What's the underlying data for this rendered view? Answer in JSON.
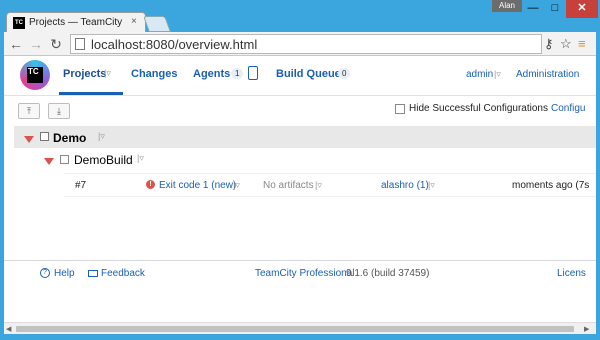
{
  "window": {
    "user_badge": "Alan",
    "minimize": "—",
    "maximize": "□",
    "close": "✕"
  },
  "browser": {
    "tab_title": "Projects — TeamCity",
    "tab_icon_text": "TC",
    "tab_close": "×",
    "url": "localhost:8080/overview.html",
    "icons": [
      "back-icon",
      "forward-icon",
      "reload-icon",
      "page-icon",
      "key-icon",
      "star-icon",
      "menu-icon"
    ]
  },
  "header": {
    "logo_text": "TC",
    "nav": {
      "projects": "Projects",
      "changes": "Changes",
      "agents": "Agents",
      "agents_count": "1",
      "build_queue": "Build Queue",
      "queue_count": "0"
    },
    "user": "admin",
    "administration": "Administration"
  },
  "toolbar": {
    "hide_successful_label": "Hide Successful Configurations",
    "hide_successful_checked": false,
    "configure_label": "Configu"
  },
  "project": {
    "name": "Demo",
    "build_config": {
      "name": "DemoBuild",
      "last_run": {
        "number": "#7",
        "status": "Exit code 1 (new)",
        "status_color": "#d9534f",
        "artifacts": "No artifacts",
        "changes": "alashro (1)",
        "time": "moments ago (7s"
      }
    }
  },
  "footer": {
    "help": "Help",
    "feedback": "Feedback",
    "product": "TeamCity Professional",
    "version": "9.1.6 (build 37459)",
    "license": "Licens"
  },
  "colors": {
    "link": "#1a5fb4",
    "error": "#d9534f",
    "window_frame": "#3aa6dd"
  }
}
